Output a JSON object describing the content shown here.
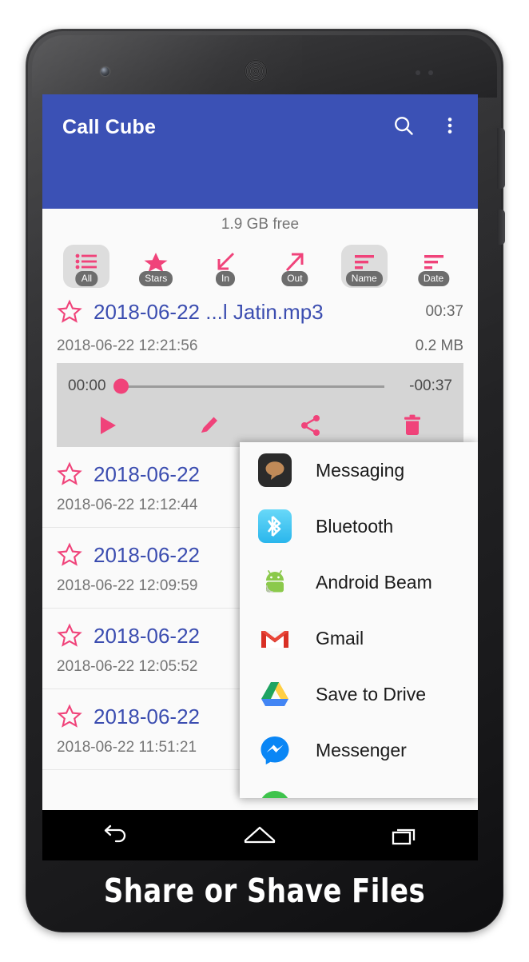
{
  "app": {
    "title": "Call Cube",
    "appbar_color": "#3b51b5",
    "accent_color": "#f0437a",
    "title_link_color": "#3b4db0",
    "search_icon": "search-icon",
    "overflow_icon": "more-vertical-icon"
  },
  "storage": {
    "free_text": "1.9 GB free"
  },
  "filters": [
    {
      "label": "All",
      "icon": "list-icon",
      "selected": true
    },
    {
      "label": "Stars",
      "icon": "star-filled-icon",
      "selected": false
    },
    {
      "label": "In",
      "icon": "arrow-incoming-icon",
      "selected": false
    },
    {
      "label": "Out",
      "icon": "arrow-outgoing-icon",
      "selected": false
    },
    {
      "label": "Name",
      "icon": "sort-by-name-icon",
      "selected": true
    },
    {
      "label": "Date",
      "icon": "sort-by-date-icon",
      "selected": false
    }
  ],
  "selected_item": {
    "star_icon": "star-outline-icon",
    "title": "2018-06-22 ...l Jatin.mp3",
    "duration": "00:37",
    "datetime": "2018-06-22 12:21:56",
    "size": "0.2 MB"
  },
  "player": {
    "elapsed": "00:00",
    "remaining": "-00:37",
    "progress_percent": 0,
    "controls": [
      {
        "name": "play-icon",
        "label": "Play"
      },
      {
        "name": "edit-icon",
        "label": "Edit"
      },
      {
        "name": "share-icon",
        "label": "Share"
      },
      {
        "name": "delete-icon",
        "label": "Delete"
      }
    ]
  },
  "list": [
    {
      "star_icon": "star-outline-icon",
      "title": "2018-06-22",
      "datetime": "2018-06-22 12:12:44"
    },
    {
      "star_icon": "star-outline-icon",
      "title": "2018-06-22",
      "datetime": "2018-06-22 12:09:59"
    },
    {
      "star_icon": "star-outline-icon",
      "title": "2018-06-22",
      "datetime": "2018-06-22 12:05:52"
    },
    {
      "star_icon": "star-outline-icon",
      "title": "2018-06-22",
      "datetime": "2018-06-22 11:51:21"
    }
  ],
  "share_sheet": {
    "items": [
      {
        "label": "Messaging",
        "icon": "messaging-app-icon"
      },
      {
        "label": "Bluetooth",
        "icon": "bluetooth-app-icon"
      },
      {
        "label": "Android Beam",
        "icon": "android-beam-app-icon"
      },
      {
        "label": "Gmail",
        "icon": "gmail-app-icon"
      },
      {
        "label": "Save to Drive",
        "icon": "google-drive-app-icon"
      },
      {
        "label": "Messenger",
        "icon": "messenger-app-icon"
      },
      {
        "label": "",
        "icon": "whatsapp-app-icon"
      }
    ]
  },
  "navigation": {
    "back": "back-icon",
    "home": "home-icon",
    "recents": "recents-icon"
  },
  "caption": {
    "text": "Share or Shave Files"
  }
}
